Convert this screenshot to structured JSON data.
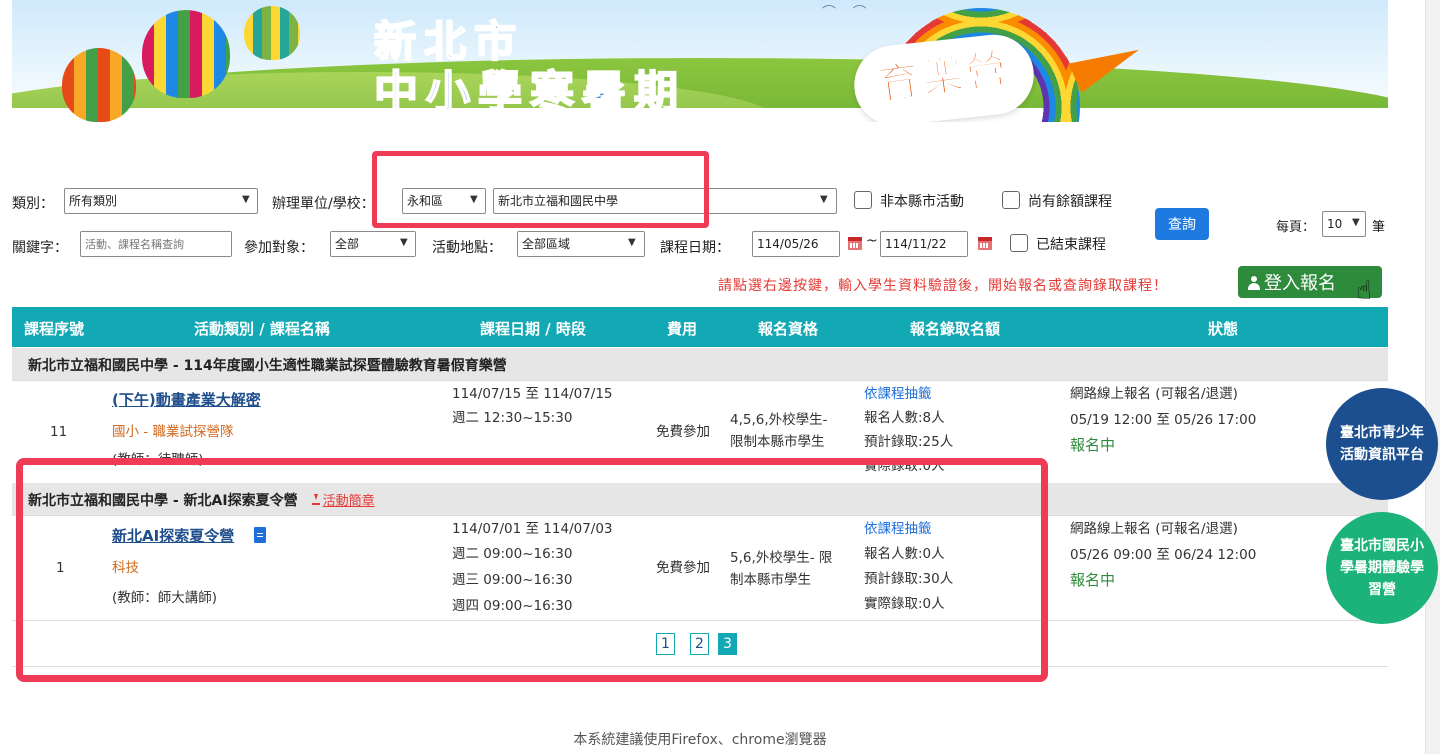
{
  "banner": {
    "title_line1": "新北市",
    "title_line2": "中小學寒暑期",
    "camp_word": "育樂營"
  },
  "filters": {
    "category_label": "類別：",
    "category_value": "所有類別",
    "organizer_label": "辦理單位/學校：",
    "district_value": "永和區",
    "school_value": "新北市立福和國民中學",
    "non_county_label": "非本縣市活動",
    "remaining_label": "尚有餘額課程",
    "query_button": "查詢",
    "per_page_label": "每頁：",
    "per_page_value": "10",
    "per_page_unit": "筆",
    "keyword_label": "關鍵字：",
    "keyword_placeholder": "活動、課程名稱查詢",
    "target_label": "參加對象：",
    "target_value": "全部",
    "location_label": "活動地點：",
    "location_value": "全部區域",
    "date_label": "課程日期：",
    "date_from": "114/05/26",
    "tilde": "~",
    "date_to": "114/11/22",
    "ended_label": "已結束課程"
  },
  "notice": "請點選右邊按鍵，輸入學生資料驗證後，開始報名或查詢錄取課程！",
  "login_button": "登入報名",
  "table": {
    "headers": [
      "課程序號",
      "活動類別 / 課程名稱",
      "課程日期 / 時段",
      "費用",
      "報名資格",
      "報名錄取名額",
      "狀態"
    ],
    "groups": [
      {
        "title": "新北市立福和國民中學 - 114年度國小生適性職業試探暨體驗教育暑假育樂營",
        "rows": [
          {
            "id": "11",
            "name": "(下午)動畫產業大解密",
            "category": "國小 - 職業試探營隊",
            "teacher": "(教師：待聘師)",
            "date_range": "114/07/15 至 114/07/15",
            "sessions": [
              "週二 12:30~15:30"
            ],
            "fee": "免費參加",
            "eligibility": [
              "4,5,6,外校學生-",
              "限制本縣市學生"
            ],
            "quota_method": "依課程抽籤",
            "enrolled": "報名人數:8人",
            "expected": "預計錄取:25人",
            "actual": "實際錄取:0人",
            "status_line1": "網路線上報名 (可報名/退選)",
            "status_line2": "05/19 12:00 至 05/26 17:00",
            "status": "報名中"
          }
        ]
      },
      {
        "title": "新北市立福和國民中學 - 新北AI探索夏令營",
        "download": "活動簡章",
        "rows": [
          {
            "id": "1",
            "name": "新北AI探索夏令營",
            "category": "科技",
            "teacher": "(教師：師大講師)",
            "date_range": "114/07/01 至 114/07/03",
            "sessions": [
              "週二 09:00~16:30",
              "週三 09:00~16:30",
              "週四 09:00~16:30"
            ],
            "fee": "免費參加",
            "eligibility": [
              "5,6,外校學生- 限",
              "制本縣市學生"
            ],
            "quota_method": "依課程抽籤",
            "enrolled": "報名人數:0人",
            "expected": "預計錄取:30人",
            "actual": "實際錄取:0人",
            "status_line1": "網路線上報名 (可報名/退選)",
            "status_line2": "05/26 09:00 至 06/24 12:00",
            "status": "報名中"
          }
        ]
      }
    ]
  },
  "pagination": {
    "pages": [
      "1",
      "2",
      "3"
    ],
    "current": "3"
  },
  "side_links": {
    "link1": [
      "臺北市青少年",
      "活動資訊平台"
    ],
    "link2": [
      "臺北市國民小",
      "學暑期體驗學",
      "習營"
    ]
  },
  "footer": "本系統建議使用Firefox、chrome瀏覽器",
  "colors": {
    "header_teal": "#12a8b4",
    "highlight_red": "#ef3b56",
    "login_green": "#2e8b3c",
    "query_blue": "#1e7ae0"
  }
}
